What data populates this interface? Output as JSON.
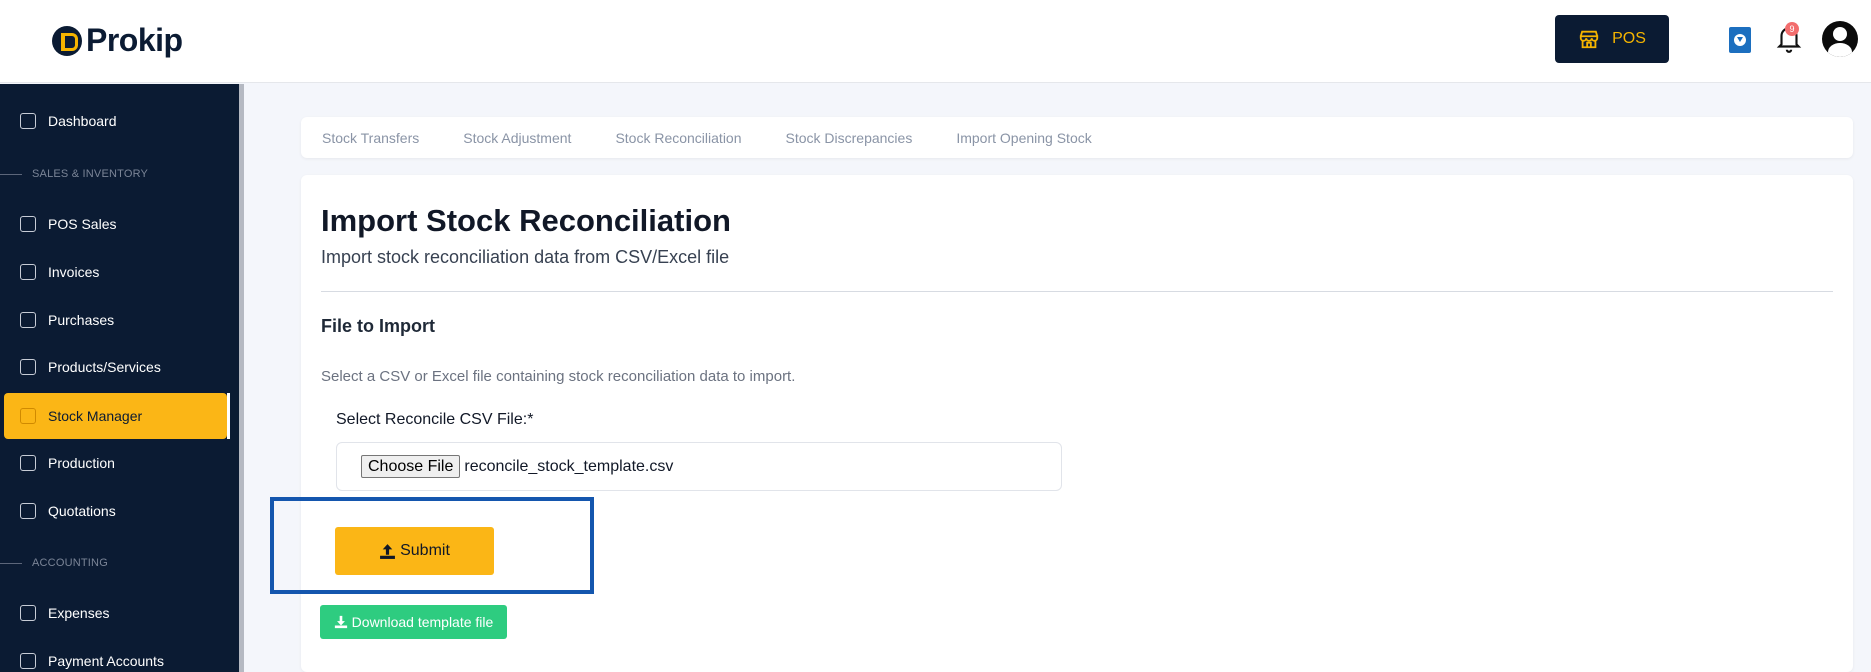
{
  "header": {
    "logo_text": "Prokip",
    "pos_label": "POS",
    "notification_count": "9"
  },
  "sidebar": {
    "items": [
      {
        "label": "Dashboard"
      },
      {
        "section": "SALES & INVENTORY"
      },
      {
        "label": "POS Sales"
      },
      {
        "label": "Invoices"
      },
      {
        "label": "Purchases"
      },
      {
        "label": "Products/Services"
      },
      {
        "label": "Stock Manager",
        "active": true
      },
      {
        "label": "Production"
      },
      {
        "label": "Quotations"
      },
      {
        "section": "ACCOUNTING"
      },
      {
        "label": "Expenses"
      },
      {
        "label": "Payment Accounts"
      }
    ]
  },
  "tabs": [
    "Stock Transfers",
    "Stock Adjustment",
    "Stock Reconciliation",
    "Stock Discrepancies",
    "Import Opening Stock"
  ],
  "main": {
    "title": "Import Stock Reconciliation",
    "subtitle": "Import stock reconciliation data from CSV/Excel file",
    "section_title": "File to Import",
    "help_text": "Select a CSV or Excel file containing stock reconciliation data to import.",
    "file_label": "Select Reconcile CSV File:*",
    "choose_file_label": "Choose File",
    "file_name": "reconcile_stock_template.csv",
    "submit_label": "Submit",
    "download_label": "Download template file"
  },
  "colors": {
    "sidebar_bg": "#0b1b33",
    "accent": "#fbb616",
    "download_green": "#2ecc80",
    "highlight_blue": "#1456ae"
  }
}
